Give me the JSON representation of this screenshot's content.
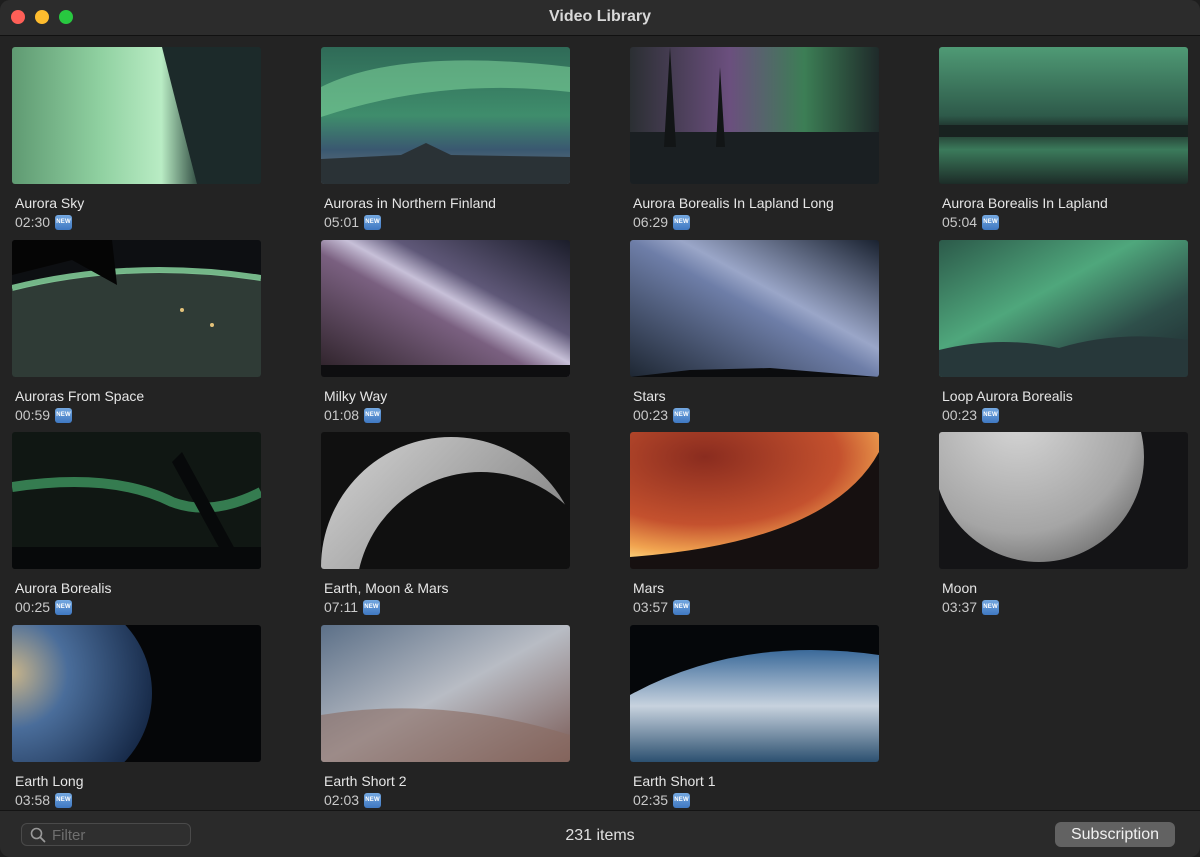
{
  "window": {
    "title": "Video Library"
  },
  "videos": [
    {
      "name": "Aurora Sky",
      "duration": "02:30",
      "badge": "NEW"
    },
    {
      "name": "Auroras in Northern Finland",
      "duration": "05:01",
      "badge": "NEW"
    },
    {
      "name": "Aurora Borealis In Lapland Long",
      "duration": "06:29",
      "badge": "NEW"
    },
    {
      "name": "Aurora Borealis In Lapland",
      "duration": "05:04",
      "badge": "NEW"
    },
    {
      "name": "Auroras From Space",
      "duration": "00:59",
      "badge": "NEW"
    },
    {
      "name": "Milky Way",
      "duration": "01:08",
      "badge": "NEW"
    },
    {
      "name": "Stars",
      "duration": "00:23",
      "badge": "NEW"
    },
    {
      "name": "Loop Aurora Borealis",
      "duration": "00:23",
      "badge": "NEW"
    },
    {
      "name": "Aurora Borealis",
      "duration": "00:25",
      "badge": "NEW"
    },
    {
      "name": "Earth, Moon & Mars",
      "duration": "07:11",
      "badge": "NEW"
    },
    {
      "name": "Mars",
      "duration": "03:57",
      "badge": "NEW"
    },
    {
      "name": "Moon",
      "duration": "03:37",
      "badge": "NEW"
    },
    {
      "name": "Earth Long",
      "duration": "03:58",
      "badge": "NEW"
    },
    {
      "name": "Earth Short 2",
      "duration": "02:03",
      "badge": "NEW"
    },
    {
      "name": "Earth Short 1",
      "duration": "02:35",
      "badge": "NEW"
    }
  ],
  "footer": {
    "filter_placeholder": "Filter",
    "item_count": "231 items",
    "subscription_label": "Subscription"
  },
  "icons": {
    "search": "search-icon",
    "new_badge": "new-badge-icon"
  },
  "colors": {
    "close": "#fe5f57",
    "minimize": "#febc2e",
    "maximize": "#28c840",
    "badge": "#4f86cc"
  }
}
